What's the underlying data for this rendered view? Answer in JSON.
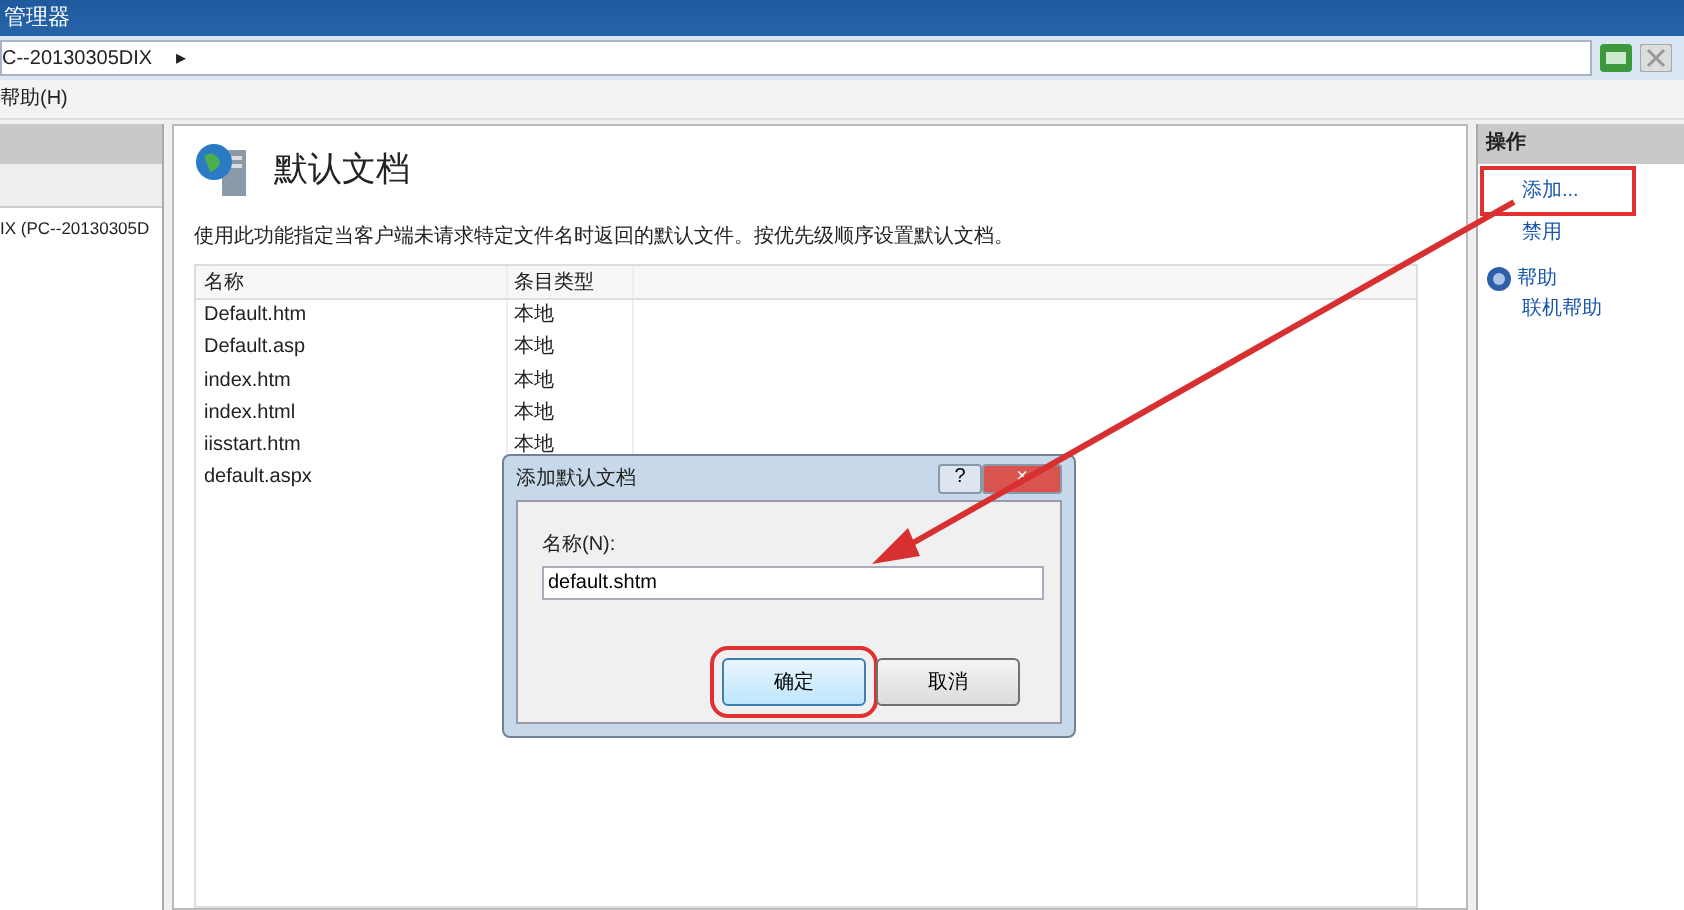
{
  "window": {
    "title": "管理器"
  },
  "address": {
    "path": "C--20130305DIX",
    "separator": "▸"
  },
  "menu": [
    "帮助(H)"
  ],
  "tree": {
    "items": [
      {
        "label": "IX (PC--20130305D",
        "selected": false
      }
    ]
  },
  "feature": {
    "title": "默认文档",
    "description": "使用此功能指定当客户端未请求特定文件名时返回的默认文件。按优先级顺序设置默认文档。",
    "table": {
      "columns": [
        "名称",
        "条目类型"
      ],
      "rows": [
        [
          "Default.htm",
          "本地"
        ],
        [
          "Default.asp",
          "本地"
        ],
        [
          "index.htm",
          "本地"
        ],
        [
          "index.html",
          "本地"
        ],
        [
          "iisstart.htm",
          "本地"
        ],
        [
          "default.aspx",
          ""
        ]
      ]
    }
  },
  "actions": {
    "title": "操作",
    "items": [
      {
        "label": "添加...",
        "kind": "link",
        "highlighted": true
      },
      {
        "label": "禁用",
        "kind": "link",
        "highlighted": false
      },
      {
        "label": "帮助",
        "kind": "help",
        "highlighted": false
      },
      {
        "label": "联机帮助",
        "kind": "link",
        "highlighted": false
      }
    ]
  },
  "dialog": {
    "title": "添加默认文档",
    "help": "?",
    "close": "×",
    "field_label": "名称(N):",
    "value": "default.shtm",
    "buttons": [
      {
        "label": "确定",
        "highlighted": true
      },
      {
        "label": "取消",
        "highlighted": false
      }
    ]
  }
}
